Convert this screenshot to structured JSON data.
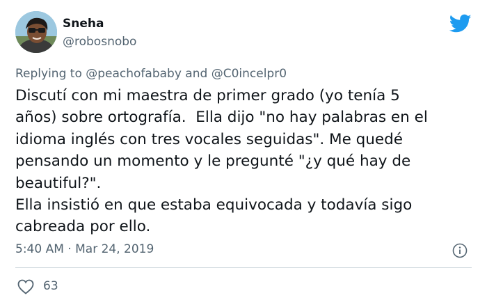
{
  "author": {
    "display_name": "Sneha",
    "handle": "@robosnobo",
    "avatar_icon": "avatar-photo"
  },
  "brand": {
    "logo_icon": "twitter-bird-icon",
    "accent_color": "#1d9bf0"
  },
  "reply": {
    "prefix": "Replying to ",
    "mention_1": "@peachofababy",
    "joiner": " and ",
    "mention_2": "@C0incelpr0"
  },
  "tweet": {
    "lines": [
      "Discutí con mi maestra de primer grado (yo tenía 5",
      "años) sobre ortografía.  Ella dijo \"no hay palabras en el",
      "idioma inglés con tres vocales seguidas\". Me quedé",
      "pensando un momento y le pregunté \"¿y qué hay de",
      "beautiful?\".",
      "Ella insistió en que estaba equivocada y todavía sigo",
      "cabreada por ello."
    ]
  },
  "meta": {
    "time": "5:40 AM",
    "separator": " · ",
    "date": "Mar 24, 2019",
    "info_icon": "info-icon"
  },
  "engagement": {
    "like_icon": "heart-icon",
    "likes": "63"
  },
  "colors": {
    "text_primary": "#0f1419",
    "text_secondary": "#536471",
    "divider": "#cfd9de"
  }
}
